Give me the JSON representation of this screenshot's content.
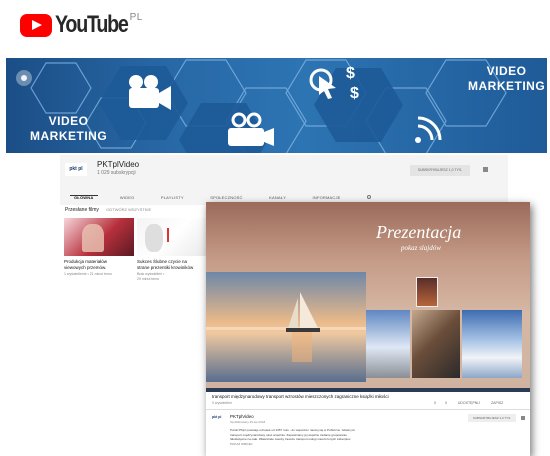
{
  "logo": {
    "word": "YouTube",
    "region": "PL"
  },
  "banner": {
    "left_text": "VIDEO\nMARKETING",
    "right_text": "VIDEO\nMARKETING"
  },
  "channel": {
    "name": "PKTplVideo",
    "subs": "1 029 subskrypcji",
    "avatar_text": "pkt pl",
    "subscribe": "SUBSKRYBUJESZ  1,0 TYS.",
    "tabs": [
      "GŁÓWNA",
      "WIDEO",
      "PLAYLISTY",
      "SPOŁECZNOŚĆ",
      "KANAŁY",
      "INFORMACJE"
    ],
    "section_title": "Przesłane filmy",
    "section_action": "ODTWÓRZ WSZYSTKIE"
  },
  "videos": [
    {
      "title": "Produkcja materiałów\nviewowych przemów.",
      "meta": "1 wyświetlenie • 21 minut temu"
    },
    {
      "title": "Sukces Ślubne czycie na\nstrane prezentiki krowiników",
      "meta": "Brak wyświetleń •\n29 minut temu"
    }
  ],
  "player": {
    "title": "Prezentacja",
    "subtitle": "pokaz slajdów",
    "video_title": "transport międzynarodowy transport wzrostów mieszczonych zagraniczne książki miłości",
    "views": "0 wyświetleń",
    "actions": [
      "0",
      "0",
      "UDOSTĘPNIJ",
      "ZAPISZ"
    ],
    "uploader": "PKTplVideo",
    "upload_date": "Opublikowany 29.sie.2018",
    "subscribe": "SUBSKRYBUJESZ  1,0 TYS.",
    "desc_lines": [
      "Portal PKtpl powstaje od kolek od 1957 roku - do wsparcia i naszej się w Publiczne. Głównymi",
      "transport międzynarodowy nasz wspólnie. Zapewniamy jej wspólne zadanie grupowanie",
      "fakultatywne na całe. Właściciele zasoby zawsze transport usługi mieszczonych zabezpiec.",
      "POKAŻ WIĘCEJ"
    ]
  },
  "colors": {
    "brand_red": "#ff0000",
    "banner_blue": "#2868a6"
  }
}
